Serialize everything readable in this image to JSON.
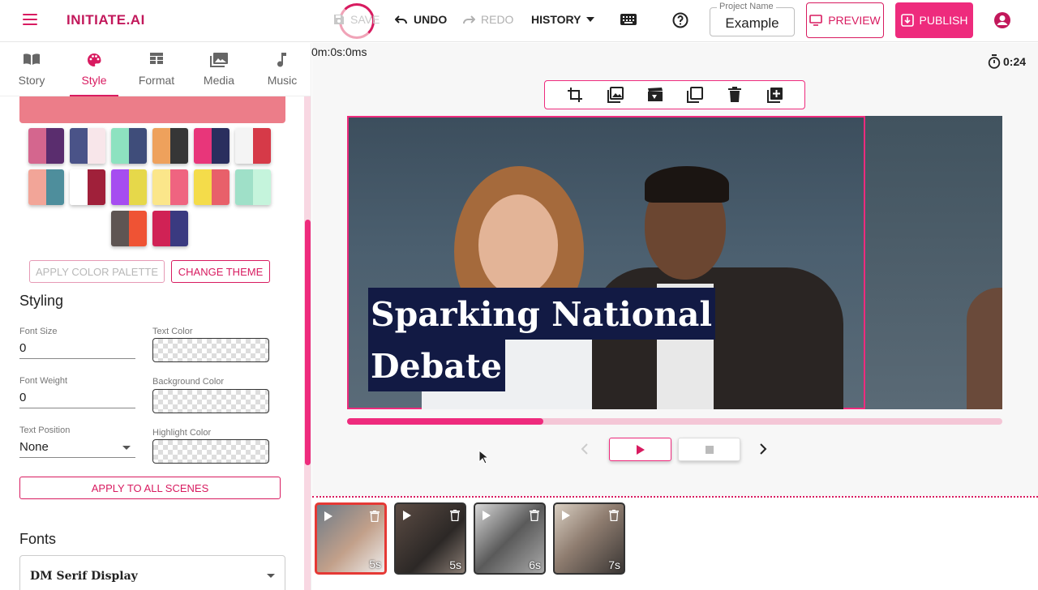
{
  "header": {
    "brand": "INITIATE.AI",
    "save_label": "SAVE",
    "undo_label": "UNDO",
    "redo_label": "REDO",
    "history_label": "HISTORY",
    "project_label": "Project Name",
    "project_value": "Example",
    "preview_label": "PREVIEW",
    "publish_label": "PUBLISH"
  },
  "tabs": [
    {
      "label": "Story",
      "icon": "book-icon"
    },
    {
      "label": "Style",
      "icon": "palette-icon",
      "active": true
    },
    {
      "label": "Format",
      "icon": "format-icon"
    },
    {
      "label": "Media",
      "icon": "media-icon"
    },
    {
      "label": "Music",
      "icon": "music-note-icon"
    }
  ],
  "palettes": {
    "current_strip_color": "#ec7d89",
    "swatches": [
      [
        "#d4668e",
        "#5a2d6e"
      ],
      [
        "#4a5388",
        "#f8e6ea"
      ],
      [
        "#8de2c0",
        "#3f4d7a"
      ],
      [
        "#eea15c",
        "#363636"
      ],
      [
        "#e8367a",
        "#2a2e5e"
      ],
      [
        "#f4f4f4",
        "#d63a48"
      ],
      [
        "#f2a598",
        "#4e8e9c"
      ],
      [
        "#ffffff",
        "#a0203a"
      ],
      [
        "#a64df0",
        "#e6d84a"
      ],
      [
        "#fbe68a",
        "#ef6480"
      ],
      [
        "#f4dc4a",
        "#e8606a"
      ],
      [
        "#9fe0c8",
        "#c5f4dc"
      ],
      [
        "#5e5553",
        "#ef5334"
      ],
      [
        "#d02255",
        "#3a3a80"
      ]
    ],
    "apply_label": "APPLY COLOR PALETTE",
    "change_theme_label": "CHANGE THEME"
  },
  "styling": {
    "title": "Styling",
    "font_size_label": "Font Size",
    "font_size_value": "0",
    "text_color_label": "Text Color",
    "font_weight_label": "Font Weight",
    "font_weight_value": "0",
    "background_color_label": "Background Color",
    "text_position_label": "Text Position",
    "text_position_value": "None",
    "highlight_color_label": "Highlight Color",
    "apply_all_label": "APPLY TO ALL SCENES"
  },
  "fonts": {
    "title": "Fonts",
    "selected": "DM Serif Display"
  },
  "editor": {
    "timecode": "0m:0s:0ms",
    "duration": "0:24",
    "caption_line1": "Sparking National",
    "caption_line2": "Debate",
    "progress_fraction": 0.3
  },
  "scenes": [
    {
      "duration": "5s",
      "selected": true
    },
    {
      "duration": "5s"
    },
    {
      "duration": "6s"
    },
    {
      "duration": "7s"
    }
  ],
  "colors": {
    "accent": "#ee2b7d",
    "brand": "#c2185b",
    "caption_bg": "#121a44"
  }
}
